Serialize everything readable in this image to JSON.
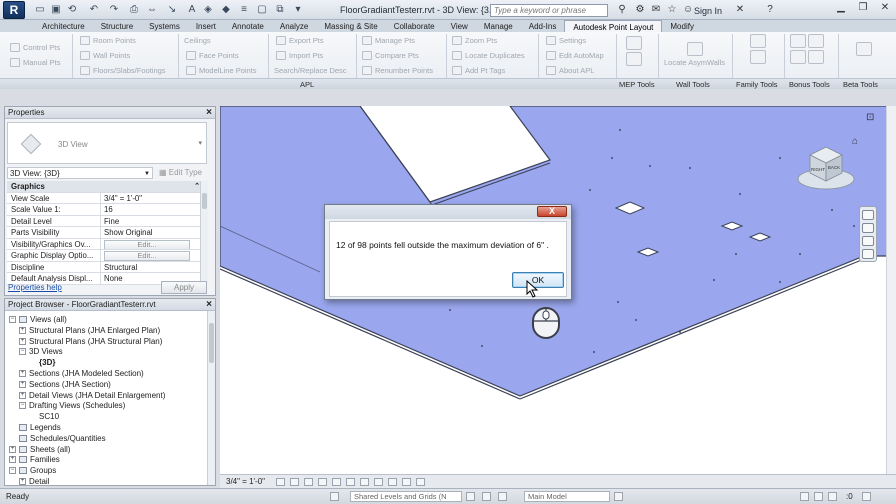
{
  "titlebar": {
    "app_letter": "R",
    "window_title": "FloorGradiantTesterr.rvt - 3D View: {3...",
    "search_placeholder": "Type a keyword or phrase",
    "sign_in": "Sign In"
  },
  "tabs": [
    "Architecture",
    "Structure",
    "Systems",
    "Insert",
    "Annotate",
    "Analyze",
    "Massing & Site",
    "Collaborate",
    "View",
    "Manage",
    "Add-Ins",
    "Autodesk Point Layout",
    "Modify"
  ],
  "active_tab": "Autodesk Point Layout",
  "ribbon": {
    "col1": [
      "Control Pts",
      "Manual Pts"
    ],
    "col2": [
      "Room Points",
      "Wall Points",
      "Floors/Slabs/Footings"
    ],
    "col3": [
      "Ceilings",
      "Face Points",
      "ModelLine Points"
    ],
    "col3b": "Search/Replace Desc",
    "col4": [
      "Export Pts",
      "Import Pts"
    ],
    "col5": [
      "Manage Pts",
      "Compare Pts",
      "Renumber Points"
    ],
    "col6": [
      "Zoom Pts",
      "Locate Duplicates",
      "Add Pt Tags"
    ],
    "col7": [
      "Settings",
      "Edit AutoMap",
      "About APL"
    ],
    "locate_asym": "Locate AsymWalls",
    "panels": [
      "APL",
      "MEP Tools",
      "Wall Tools",
      "Family Tools",
      "Bonus Tools",
      "Beta Tools"
    ]
  },
  "properties": {
    "title": "Properties",
    "type_name": "3D View",
    "instance_selector": "3D View: {3D}",
    "edit_type": "Edit Type",
    "group": "Graphics",
    "rows": [
      {
        "name": "View Scale",
        "value": "3/4\" = 1'-0\""
      },
      {
        "name": "Scale Value    1:",
        "value": "16"
      },
      {
        "name": "Detail Level",
        "value": "Fine"
      },
      {
        "name": "Parts Visibility",
        "value": "Show Original"
      },
      {
        "name": "Visibility/Graphics Ov...",
        "value": "Edit..."
      },
      {
        "name": "Graphic Display Optio...",
        "value": "Edit..."
      },
      {
        "name": "Discipline",
        "value": "Structural"
      },
      {
        "name": "Default Analysis Displ...",
        "value": "None"
      }
    ],
    "help": "Properties help",
    "apply": "Apply"
  },
  "browser": {
    "title": "Project Browser - FloorGradiantTesterr.rvt",
    "items": [
      {
        "label": "Views (all)",
        "indent": 0,
        "exp": "−"
      },
      {
        "label": "Structural Plans (JHA Enlarged Plan)",
        "indent": 1,
        "exp": "+"
      },
      {
        "label": "Structural Plans (JHA Structural Plan)",
        "indent": 1,
        "exp": "+"
      },
      {
        "label": "3D Views",
        "indent": 1,
        "exp": "−"
      },
      {
        "label": "{3D}",
        "indent": 2,
        "exp": ""
      },
      {
        "label": "Sections (JHA Modeled Section)",
        "indent": 1,
        "exp": "+"
      },
      {
        "label": "Sections (JHA Section)",
        "indent": 1,
        "exp": "+"
      },
      {
        "label": "Detail Views (JHA Detail Enlargement)",
        "indent": 1,
        "exp": "+"
      },
      {
        "label": "Drafting Views (Schedules)",
        "indent": 1,
        "exp": "−"
      },
      {
        "label": "SC10",
        "indent": 2,
        "exp": ""
      },
      {
        "label": "Legends",
        "indent": 0,
        "exp": ""
      },
      {
        "label": "Schedules/Quantities",
        "indent": 0,
        "exp": ""
      },
      {
        "label": "Sheets (all)",
        "indent": 0,
        "exp": "+"
      },
      {
        "label": "Families",
        "indent": 0,
        "exp": "+"
      },
      {
        "label": "Groups",
        "indent": 0,
        "exp": "−"
      },
      {
        "label": "Detail",
        "indent": 1,
        "exp": "+"
      }
    ]
  },
  "viewbar": {
    "scale": "3/4\" = 1'-0\""
  },
  "viewcube": {
    "left": "RIGHT",
    "right": "BACK"
  },
  "status": {
    "text": "Ready",
    "worksets": "Shared Levels and Grids (N",
    "model": "Main Model",
    "zero": ":0"
  },
  "dialog": {
    "message": "12 of 98 points fell outside the maximum deviation of 6\" .",
    "ok": "OK",
    "close": "X"
  },
  "colors": {
    "floor": "#9aa7ee",
    "floor_edge": "#3b4157",
    "ribbon_bg": "#eef1f5",
    "ok_border": "#3c7fb1"
  }
}
